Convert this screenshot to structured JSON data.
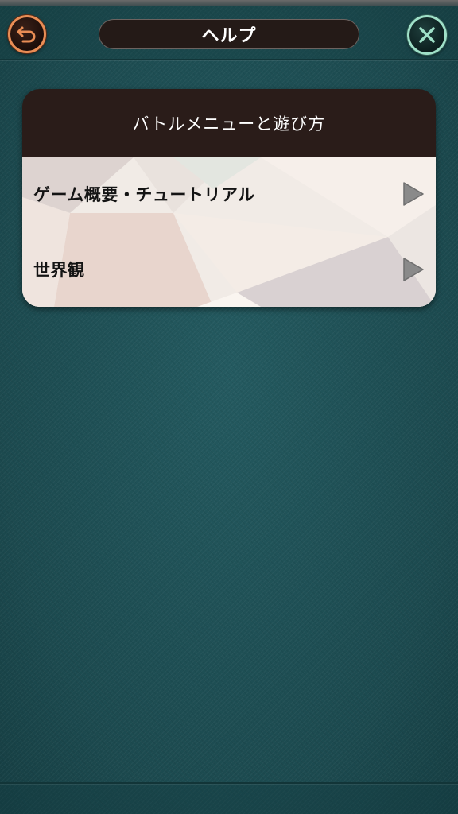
{
  "header": {
    "title": "ヘルプ",
    "back_icon": "undo-arrow-icon",
    "close_icon": "close-x-icon"
  },
  "menu": {
    "heading": "バトルメニューと遊び方",
    "items": [
      {
        "label": "ゲーム概要・チュートリアル",
        "icon": "play-arrow-icon"
      },
      {
        "label": "世界観",
        "icon": "play-arrow-icon"
      }
    ]
  },
  "colors": {
    "background": "#1f5156",
    "back_button_ring": "#e98d55",
    "close_button_ring": "#9fe0c8",
    "title_pill": "#241a17",
    "card_header": "#2a1c19",
    "card_body": "#f0e8e2",
    "arrow": "#8a8a8a"
  }
}
